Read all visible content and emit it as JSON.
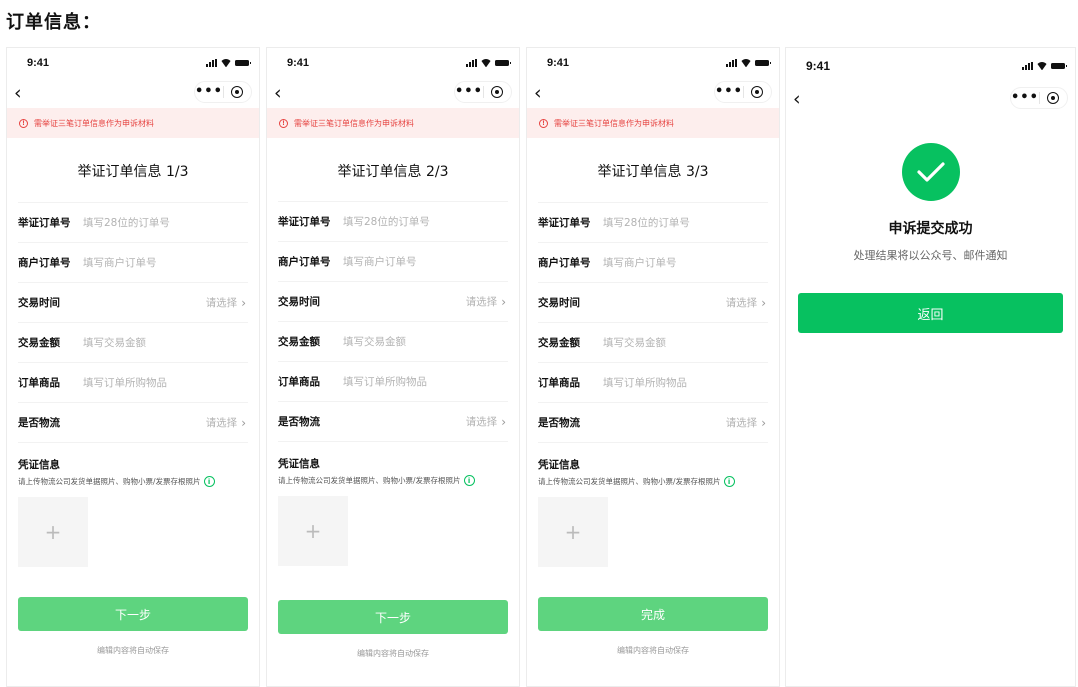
{
  "page": {
    "title": "订单信息："
  },
  "status": {
    "time": "9:41"
  },
  "banner": {
    "text": "需举证三笔订单信息作为申诉材料"
  },
  "forms": [
    {
      "title": "举证订单信息 1/3",
      "fields": [
        {
          "label": "举证订单号",
          "placeholder": "填写28位的订单号",
          "type": "input"
        },
        {
          "label": "商户订单号",
          "placeholder": "填写商户订单号",
          "type": "input"
        },
        {
          "label": "交易时间",
          "placeholder": "请选择",
          "type": "select"
        },
        {
          "label": "交易金额",
          "placeholder": "填写交易金额",
          "type": "input"
        },
        {
          "label": "订单商品",
          "placeholder": "填写订单所购物品",
          "type": "input"
        },
        {
          "label": "是否物流",
          "placeholder": "请选择",
          "type": "select"
        }
      ],
      "voucher_title": "凭证信息",
      "voucher_desc": "请上传物流公司发货单据照片、购物小票/发票存根照片",
      "button": "下一步",
      "hint": "编辑内容将自动保存"
    },
    {
      "title": "举证订单信息 2/3",
      "fields": [
        {
          "label": "举证订单号",
          "placeholder": "填写28位的订单号",
          "type": "input"
        },
        {
          "label": "商户订单号",
          "placeholder": "填写商户订单号",
          "type": "input"
        },
        {
          "label": "交易时间",
          "placeholder": "请选择",
          "type": "select"
        },
        {
          "label": "交易金额",
          "placeholder": "填写交易金额",
          "type": "input"
        },
        {
          "label": "订单商品",
          "placeholder": "填写订单所购物品",
          "type": "input"
        },
        {
          "label": "是否物流",
          "placeholder": "请选择",
          "type": "select"
        }
      ],
      "voucher_title": "凭证信息",
      "voucher_desc": "请上传物流公司发货单据照片、购物小票/发票存根照片",
      "button": "下一步",
      "hint": "编辑内容将自动保存"
    },
    {
      "title": "举证订单信息 3/3",
      "fields": [
        {
          "label": "举证订单号",
          "placeholder": "填写28位的订单号",
          "type": "input"
        },
        {
          "label": "商户订单号",
          "placeholder": "填写商户订单号",
          "type": "input"
        },
        {
          "label": "交易时间",
          "placeholder": "请选择",
          "type": "select"
        },
        {
          "label": "交易金额",
          "placeholder": "填写交易金额",
          "type": "input"
        },
        {
          "label": "订单商品",
          "placeholder": "填写订单所购物品",
          "type": "input"
        },
        {
          "label": "是否物流",
          "placeholder": "请选择",
          "type": "select"
        }
      ],
      "voucher_title": "凭证信息",
      "voucher_desc": "请上传物流公司发货单据照片、购物小票/发票存根照片",
      "button": "完成",
      "hint": "编辑内容将自动保存"
    }
  ],
  "success": {
    "title": "申诉提交成功",
    "desc": "处理结果将以公众号、邮件通知",
    "button": "返回"
  },
  "colors": {
    "brand": "#07c160",
    "button_disabled": "#5ed47f",
    "banner_bg": "#fdeeed",
    "banner_text": "#e64340"
  },
  "icons": {
    "back": "chevron-left",
    "more": "ellipsis",
    "close": "target",
    "warn": "exclamation-circle",
    "info": "info-circle",
    "success": "check-circle",
    "upload": "plus"
  }
}
